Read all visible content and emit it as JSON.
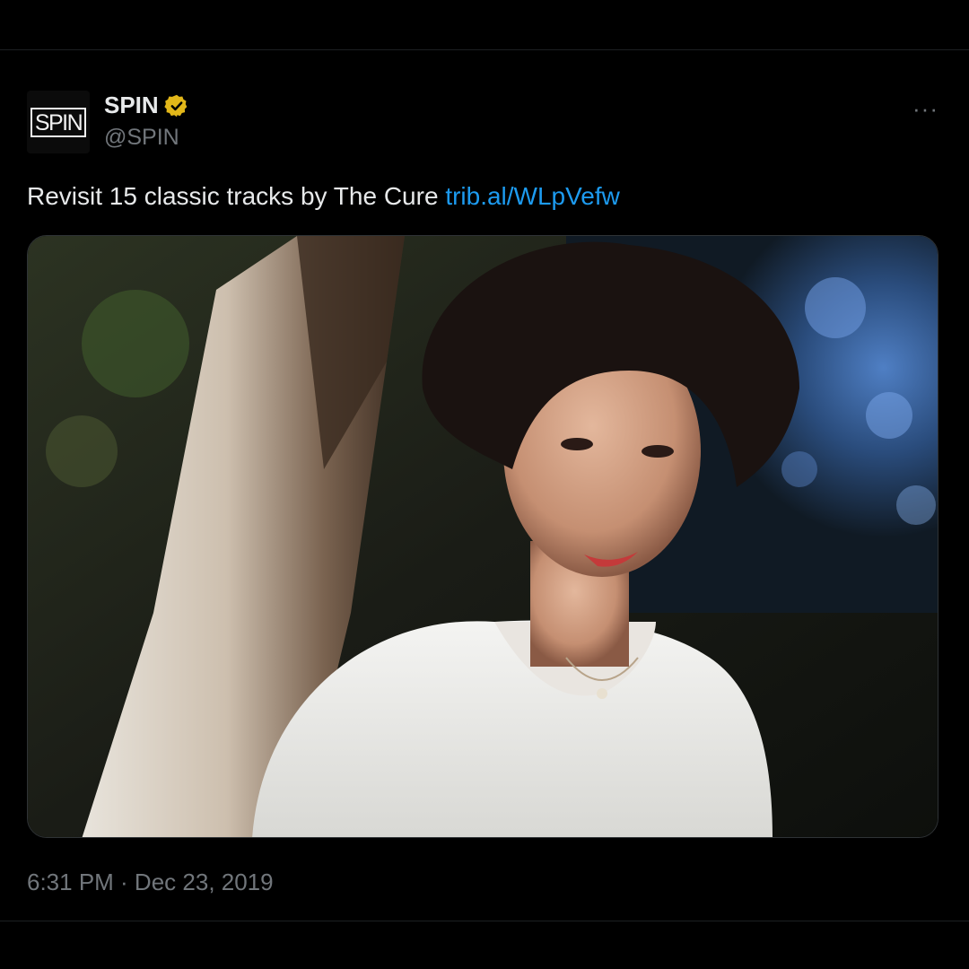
{
  "account": {
    "avatar_logo": "SPIN",
    "display_name": "SPIN",
    "handle": "@SPIN",
    "verified_badge_color": "#e2b719"
  },
  "menu": {
    "more_label": "···"
  },
  "tweet": {
    "text": "Revisit 15 classic tracks by The Cure ",
    "link": "trib.al/WLpVefw",
    "link_color": "#1d9bf0",
    "timestamp": "6:31 PM · Dec 23, 2019"
  },
  "icons": {
    "verified": "verified-badge-icon",
    "more": "more-icon"
  }
}
